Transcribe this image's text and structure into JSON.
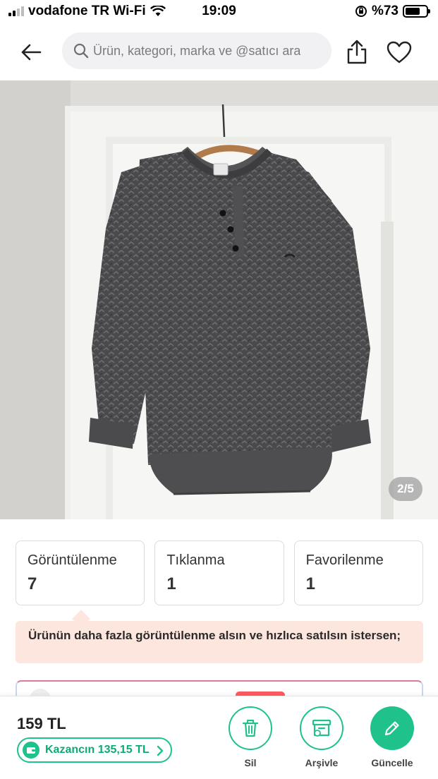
{
  "status_bar": {
    "carrier": "vodafone TR Wi-Fi",
    "time": "19:09",
    "battery_text": "%73",
    "battery_level": 0.73
  },
  "nav": {
    "search_placeholder": "Ürün, kategori, marka ve @satıcı ara"
  },
  "gallery": {
    "counter": "2/5"
  },
  "stats": [
    {
      "label": "Görüntülenme",
      "value": "7"
    },
    {
      "label": "Tıklanma",
      "value": "1"
    },
    {
      "label": "Favorilenme",
      "value": "1"
    }
  ],
  "promo": {
    "text": "Ürünün daha fazla görüntülenme alsın ve hızlıca satılsın istersen;"
  },
  "bottom": {
    "price": "159 TL",
    "earnings": "Kazancın 135,15 TL",
    "actions": [
      {
        "label": "Sil",
        "icon": "trash-icon"
      },
      {
        "label": "Arşivle",
        "icon": "archive-icon"
      },
      {
        "label": "Güncelle",
        "icon": "pencil-icon"
      }
    ]
  },
  "colors": {
    "accent": "#1ec28a",
    "promo_bg": "#fde6dd"
  }
}
